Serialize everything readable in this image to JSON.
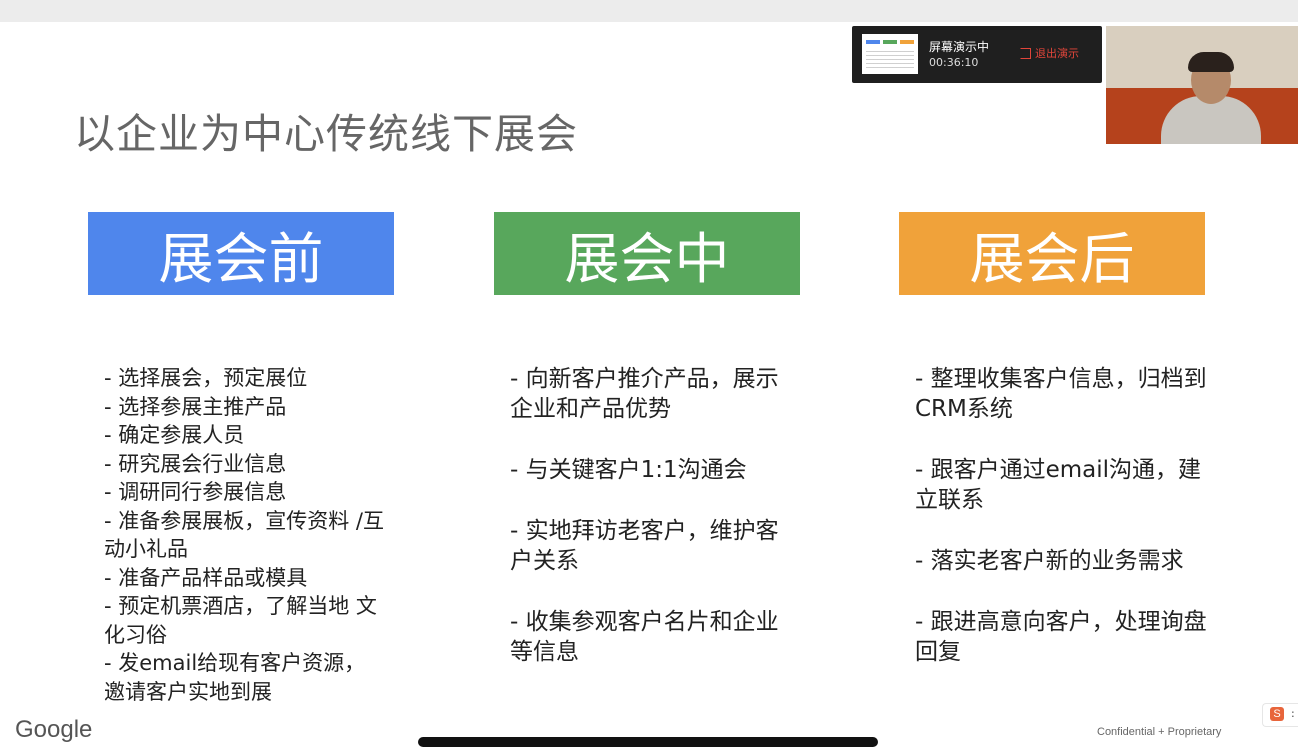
{
  "slide": {
    "title": "以企业为中心传统线下展会",
    "phases": [
      {
        "label": "展会前",
        "color": "#4f86ec",
        "items": [
          "- 选择展会，预定展位",
          "- 选择参展主推产品",
          "- 确定参展人员",
          "- 研究展会行业信息",
          "- 调研同行参展信息",
          "- 准备参展展板，宣传资料 /互动小礼品",
          "- 准备产品样品或模具",
          "- 预定机票酒店，了解当地 文化习俗",
          "- 发email给现有客户资源， 邀请客户实地到展"
        ]
      },
      {
        "label": "展会中",
        "color": "#58a75c",
        "items": [
          "- 向新客户推介产品，展示企业和产品优势",
          "- 与关键客户1:1沟通会",
          "- 实地拜访老客户，维护客户关系",
          "- 收集参观客户名片和企业等信息"
        ]
      },
      {
        "label": "展会后",
        "color": "#f0a23a",
        "items": [
          "- 整理收集客户信息，归档到CRM系统",
          "- 跟客户通过email沟通，建立联系",
          "- 落实老客户新的业务需求",
          "- 跟进高意向客户，处理询盘回复"
        ]
      }
    ],
    "footer": {
      "logo": "Google",
      "confidential": "Confidential + Proprietary"
    }
  },
  "presenting": {
    "status": "屏幕演示中",
    "elapsed": "00:36:10",
    "exit_label": "退出演示"
  },
  "widget": {
    "letter": "S",
    "dots": ":"
  }
}
